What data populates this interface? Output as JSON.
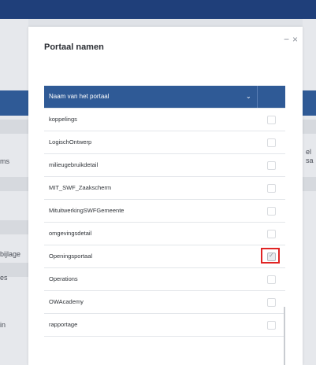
{
  "modal": {
    "title": "Portaal namen",
    "minimize_glyph": "−",
    "close_glyph": "×"
  },
  "table": {
    "column_name": "Naam van het portaal",
    "sort_glyph": "⌄",
    "rows": [
      {
        "name": "koppelings",
        "checked": false
      },
      {
        "name": "LogischOntwerp",
        "checked": false
      },
      {
        "name": "milieugebruikdetail",
        "checked": false
      },
      {
        "name": "MIT_SWF_Zaakscherm",
        "checked": false
      },
      {
        "name": "MituitwerkingSWFGemeente",
        "checked": false
      },
      {
        "name": "omgevingsdetail",
        "checked": false
      },
      {
        "name": "Openingsportaal",
        "checked": true
      },
      {
        "name": "Operations",
        "checked": false
      },
      {
        "name": "OWAcademy",
        "checked": false
      },
      {
        "name": "rapportage",
        "checked": false
      }
    ]
  },
  "background": {
    "left_fragments": [
      "ms",
      "bijlage",
      "es",
      "in"
    ],
    "right_fragments": [
      "el",
      "sa"
    ]
  },
  "colors": {
    "topbar": "#1f3f7a",
    "header": "#2f5a96",
    "highlight": "#e02424"
  }
}
